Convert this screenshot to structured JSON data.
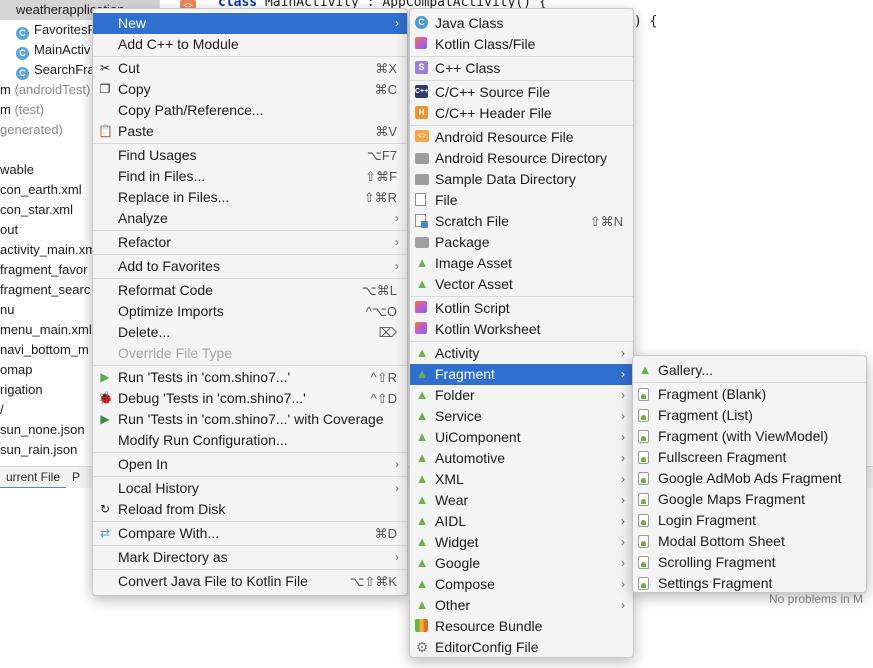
{
  "editor": {
    "code_line_1_kw": "class",
    "code_line_1_rest": " MainActivity : AppCompatActivity() {",
    "code_line_2": ") {"
  },
  "project_tree": {
    "items": [
      {
        "label": "weatherapplication",
        "muted": ""
      },
      {
        "label": "FavoritesF",
        "muted": ""
      },
      {
        "label": "MainActiv",
        "muted": ""
      },
      {
        "label": "SearchFra",
        "muted": ""
      },
      {
        "label": "m ",
        "muted": "(androidTest)"
      },
      {
        "label": "m ",
        "muted": "(test)"
      },
      {
        "label": "",
        "muted": "generated)"
      },
      {
        "label": "wable",
        "muted": ""
      },
      {
        "label": "con_earth.xml",
        "muted": ""
      },
      {
        "label": "con_star.xml",
        "muted": ""
      },
      {
        "label": "out",
        "muted": ""
      },
      {
        "label": "activity_main.xm",
        "muted": ""
      },
      {
        "label": "fragment_favor",
        "muted": ""
      },
      {
        "label": "fragment_searc",
        "muted": ""
      },
      {
        "label": "nu",
        "muted": ""
      },
      {
        "label": "menu_main.xml",
        "muted": ""
      },
      {
        "label": "navi_bottom_m",
        "muted": ""
      },
      {
        "label": "omap",
        "muted": ""
      },
      {
        "label": "rigation",
        "muted": ""
      },
      {
        "label": "/",
        "muted": ""
      },
      {
        "label": "sun_none.json",
        "muted": ""
      },
      {
        "label": "sun_rain.json",
        "muted": ""
      }
    ]
  },
  "bottom_tabs": [
    "urrent File",
    "P"
  ],
  "problems_text": "No problems in M",
  "context_menu": {
    "items": [
      {
        "label": "New",
        "arrow": true,
        "highlight": true
      },
      {
        "label": "Add C++ to Module"
      },
      {
        "sep": true
      },
      {
        "label": "Cut",
        "shortcut": "⌘X",
        "icon": "cut-icon",
        "glyph": "✂"
      },
      {
        "label": "Copy",
        "shortcut": "⌘C",
        "icon": "copy-icon",
        "glyph": "❐"
      },
      {
        "label": "Copy Path/Reference..."
      },
      {
        "label": "Paste",
        "shortcut": "⌘V",
        "icon": "paste-icon",
        "glyph": "📋"
      },
      {
        "sep": true
      },
      {
        "label": "Find Usages",
        "shortcut": "⌥F7"
      },
      {
        "label": "Find in Files...",
        "shortcut": "⇧⌘F"
      },
      {
        "label": "Replace in Files...",
        "shortcut": "⇧⌘R"
      },
      {
        "label": "Analyze",
        "arrow": true
      },
      {
        "sep": true
      },
      {
        "label": "Refactor",
        "arrow": true
      },
      {
        "sep": true
      },
      {
        "label": "Add to Favorites",
        "arrow": true
      },
      {
        "sep": true
      },
      {
        "label": "Reformat Code",
        "shortcut": "⌥⌘L"
      },
      {
        "label": "Optimize Imports",
        "shortcut": "^⌥O"
      },
      {
        "label": "Delete...",
        "shortcut": "⌦"
      },
      {
        "label": "Override File Type",
        "disabled": true
      },
      {
        "sep": true
      },
      {
        "label": "Run 'Tests in 'com.shino7...'",
        "shortcut": "^⇧R",
        "icon": "run-icon",
        "glyph": "▶"
      },
      {
        "label": "Debug 'Tests in 'com.shino7...'",
        "shortcut": "^⇧D",
        "icon": "debug-icon",
        "glyph": "🐞"
      },
      {
        "label": "Run 'Tests in 'com.shino7...' with Coverage",
        "icon": "coverage-icon",
        "glyph": "▶"
      },
      {
        "label": "Modify Run Configuration..."
      },
      {
        "sep": true
      },
      {
        "label": "Open In",
        "arrow": true
      },
      {
        "sep": true
      },
      {
        "label": "Local History",
        "arrow": true
      },
      {
        "label": "Reload from Disk",
        "icon": "reload-icon",
        "glyph": "↻"
      },
      {
        "sep": true
      },
      {
        "label": "Compare With...",
        "shortcut": "⌘D",
        "icon": "compare-icon",
        "glyph": "⇄"
      },
      {
        "sep": true
      },
      {
        "label": "Mark Directory as",
        "arrow": true
      },
      {
        "sep": true
      },
      {
        "label": "Convert Java File to Kotlin File",
        "shortcut": "⌥⇧⌘K"
      }
    ]
  },
  "new_submenu": {
    "items": [
      {
        "label": "Java Class",
        "icon": "java-class-icon",
        "kind": "c",
        "glyph": "C"
      },
      {
        "label": "Kotlin Class/File",
        "icon": "kotlin-file-icon",
        "kind": "k"
      },
      {
        "sep": true
      },
      {
        "label": "C++ Class",
        "icon": "cpp-class-icon",
        "kind": "s",
        "glyph": "S"
      },
      {
        "sep": true
      },
      {
        "label": "C/C++ Source File",
        "icon": "cpp-source-icon",
        "kind": "cpp",
        "glyph": "C++"
      },
      {
        "label": "C/C++ Header File",
        "icon": "cpp-header-icon",
        "kind": "h",
        "glyph": "H"
      },
      {
        "sep": true
      },
      {
        "label": "Android Resource File",
        "icon": "resource-file-icon",
        "kind": "res",
        "glyph": "<>"
      },
      {
        "label": "Android Resource Directory",
        "icon": "folder-icon",
        "kind": "folder"
      },
      {
        "label": "Sample Data Directory",
        "icon": "folder-icon",
        "kind": "folder"
      },
      {
        "label": "File",
        "icon": "file-icon",
        "kind": "file"
      },
      {
        "label": "Scratch File",
        "shortcut": "⇧⌘N",
        "icon": "scratch-file-icon",
        "kind": "scratch"
      },
      {
        "label": "Package",
        "icon": "package-icon",
        "kind": "pkg"
      },
      {
        "label": "Image Asset",
        "icon": "android-icon",
        "kind": "android"
      },
      {
        "label": "Vector Asset",
        "icon": "android-icon",
        "kind": "android"
      },
      {
        "sep": true
      },
      {
        "label": "Kotlin Script",
        "icon": "kotlin-script-icon",
        "kind": "k"
      },
      {
        "label": "Kotlin Worksheet",
        "icon": "kotlin-worksheet-icon",
        "kind": "k"
      },
      {
        "sep": true
      },
      {
        "label": "Activity",
        "arrow": true,
        "icon": "android-icon",
        "kind": "android"
      },
      {
        "label": "Fragment",
        "arrow": true,
        "highlight": true,
        "icon": "android-icon",
        "kind": "android"
      },
      {
        "label": "Folder",
        "arrow": true,
        "icon": "android-icon",
        "kind": "android"
      },
      {
        "label": "Service",
        "arrow": true,
        "icon": "android-icon",
        "kind": "android"
      },
      {
        "label": "UiComponent",
        "arrow": true,
        "icon": "android-icon",
        "kind": "android"
      },
      {
        "label": "Automotive",
        "arrow": true,
        "icon": "android-icon",
        "kind": "android"
      },
      {
        "label": "XML",
        "arrow": true,
        "icon": "android-icon",
        "kind": "android"
      },
      {
        "label": "Wear",
        "arrow": true,
        "icon": "android-icon",
        "kind": "android"
      },
      {
        "label": "AIDL",
        "arrow": true,
        "icon": "android-icon",
        "kind": "android"
      },
      {
        "label": "Widget",
        "arrow": true,
        "icon": "android-icon",
        "kind": "android"
      },
      {
        "label": "Google",
        "arrow": true,
        "icon": "android-icon",
        "kind": "android"
      },
      {
        "label": "Compose",
        "arrow": true,
        "icon": "android-icon",
        "kind": "android"
      },
      {
        "label": "Other",
        "arrow": true,
        "icon": "android-icon",
        "kind": "android"
      },
      {
        "label": "Resource Bundle",
        "icon": "resource-bundle-icon",
        "kind": "bundle"
      },
      {
        "label": "EditorConfig File",
        "icon": "gear-icon",
        "kind": "gear",
        "glyph": "⚙"
      }
    ]
  },
  "fragment_submenu": {
    "items": [
      {
        "label": "Gallery...",
        "icon": "android-icon",
        "kind": "android"
      },
      {
        "sep": true
      },
      {
        "label": "Fragment (Blank)",
        "icon": "fragment-icon",
        "kind": "frag"
      },
      {
        "label": "Fragment (List)",
        "icon": "fragment-icon",
        "kind": "frag"
      },
      {
        "label": "Fragment (with ViewModel)",
        "icon": "fragment-icon",
        "kind": "frag"
      },
      {
        "label": "Fullscreen Fragment",
        "icon": "fragment-icon",
        "kind": "frag"
      },
      {
        "label": "Google AdMob Ads Fragment",
        "icon": "fragment-icon",
        "kind": "frag"
      },
      {
        "label": "Google Maps Fragment",
        "icon": "fragment-icon",
        "kind": "frag"
      },
      {
        "label": "Login Fragment",
        "icon": "fragment-icon",
        "kind": "frag"
      },
      {
        "label": "Modal Bottom Sheet",
        "icon": "fragment-icon",
        "kind": "frag"
      },
      {
        "label": "Scrolling Fragment",
        "icon": "fragment-icon",
        "kind": "frag"
      },
      {
        "label": "Settings Fragment",
        "icon": "fragment-icon",
        "kind": "frag"
      }
    ]
  },
  "colors": {
    "highlight": "#2e6fd0",
    "android_green": "#6ab344"
  }
}
